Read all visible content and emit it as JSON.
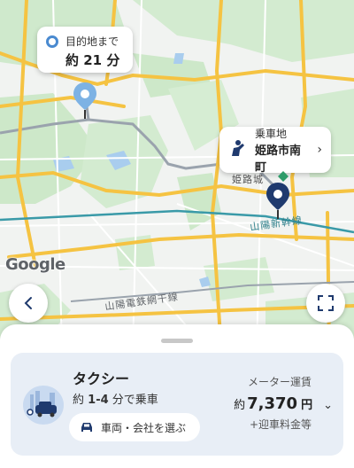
{
  "map": {
    "castle_label": "姫路城",
    "shinkansen_label": "山陽新幹線",
    "railway_label": "山陽電鉄網干線",
    "attribution": "Google"
  },
  "destination_callout": {
    "label": "目的地まで",
    "time": "約 21 分"
  },
  "pickup_callout": {
    "label": "乗車地",
    "place": "姫路市南町"
  },
  "taxi_card": {
    "title": "タクシー",
    "eta_prefix": "約",
    "eta_value": "1-4",
    "eta_suffix": "分で乗車",
    "choose_button": "車両・会社を選ぶ",
    "meter_label": "メーター運賃",
    "price_prefix": "約",
    "price_value": "7,370",
    "price_unit": "円",
    "extra_fee": "+迎車料金等"
  },
  "icons": {
    "back": "chevron-left-icon",
    "fullscreen": "fullscreen-icon",
    "destination_dot": "destination-dot-icon",
    "pickup_person": "person-wave-icon",
    "car": "car-icon"
  }
}
